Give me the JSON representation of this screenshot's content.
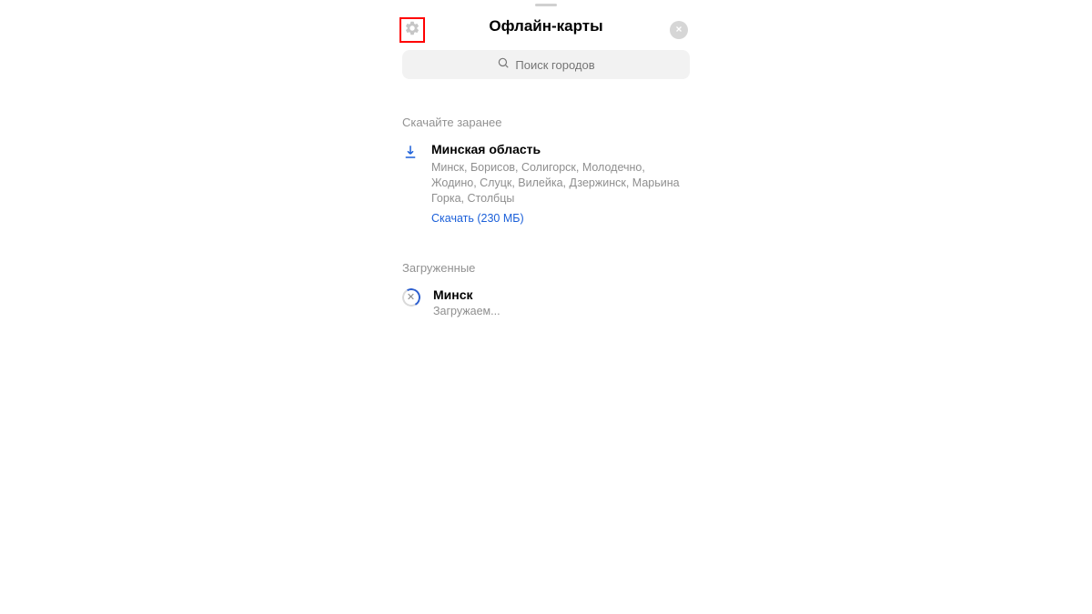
{
  "header": {
    "title": "Офлайн-карты"
  },
  "search": {
    "placeholder": "Поиск городов"
  },
  "sections": {
    "preload_title": "Скачайте заранее",
    "loaded_title": "Загруженные"
  },
  "region": {
    "name": "Минская область",
    "description": "Минск, Борисов, Солигорск, Молодечно, Жодино, Слуцк, Вилейка, Дзержинск, Марьина Горка, Столбцы",
    "download_label": "Скачать (230 МБ)"
  },
  "loaded": {
    "name": "Минск",
    "status": "Загружаем..."
  },
  "colors": {
    "link": "#1a5fd9",
    "highlight_border": "#ff0000"
  }
}
